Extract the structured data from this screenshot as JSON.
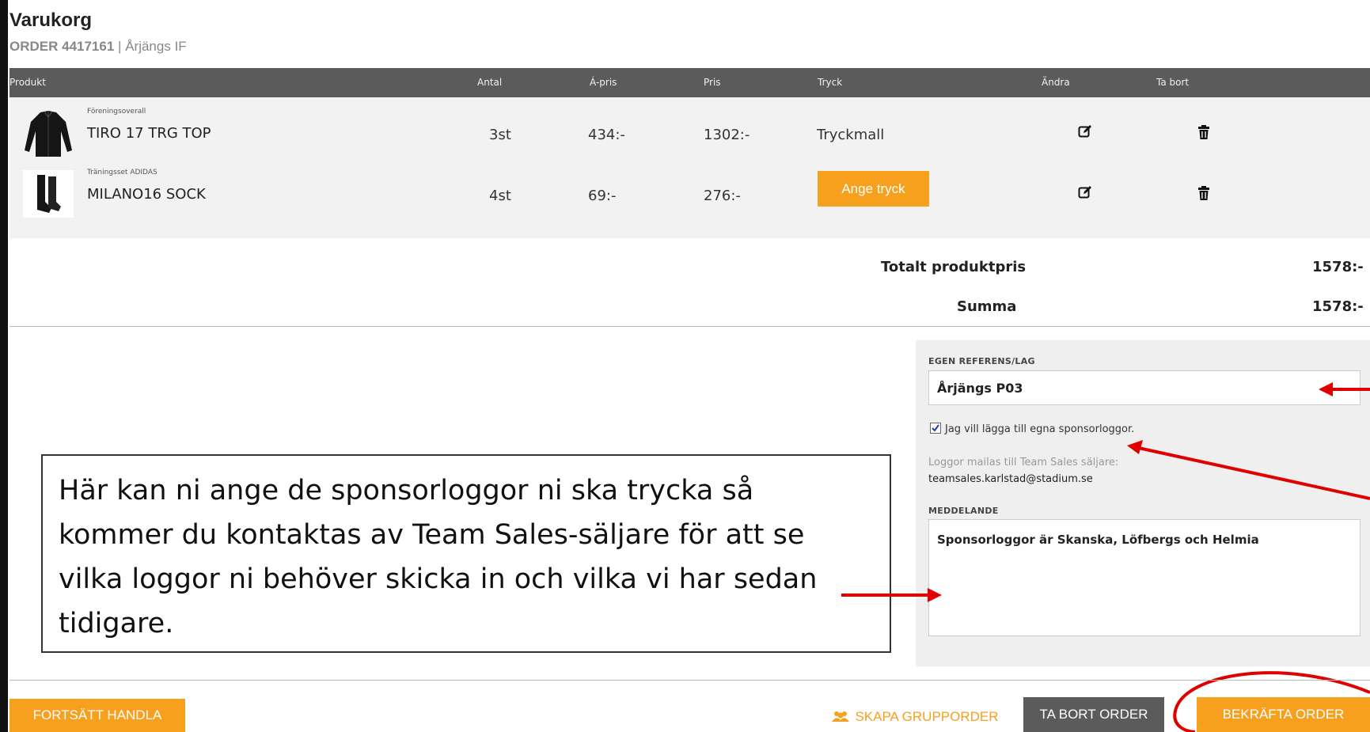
{
  "header": {
    "title": "Varukorg",
    "order_label": "ORDER 4417161",
    "separator": "|",
    "club": "Årjängs IF"
  },
  "table": {
    "columns": [
      "Produkt",
      "Antal",
      "Á-pris",
      "Pris",
      "Tryck",
      "Ändra",
      "Ta bort"
    ],
    "rows": [
      {
        "category": "Föreningsoverall",
        "name": "TIRO 17 TRG TOP",
        "qty": "3st",
        "unit_price": "434:-",
        "price": "1302:-",
        "print": "Tryckmall",
        "print_is_button": false
      },
      {
        "category": "Träningsset ADIDAS",
        "name": "MILANO16 SOCK",
        "qty": "4st",
        "unit_price": "69:-",
        "price": "276:-",
        "print": "Ange tryck",
        "print_is_button": true
      }
    ]
  },
  "totals": {
    "product_total_label": "Totalt produktpris",
    "product_total_value": "1578:-",
    "sum_label": "Summa",
    "sum_value": "1578:-"
  },
  "form": {
    "reference_label": "EGEN REFERENS/LAG",
    "reference_value": "Årjängs P03",
    "sponsor_checkbox_label": "Jag vill lägga till egna sponsorloggor.",
    "sponsor_checked": true,
    "logo_mail_note": "Loggor mailas till Team Sales säljare:",
    "logo_mail_address": "teamsales.karlstad@stadium.se",
    "message_label": "MEDDELANDE",
    "message_value": "Sponsorloggor är Skanska, Löfbergs och Helmia"
  },
  "callout": {
    "text": "Här kan ni ange de sponsorloggor ni ska trycka så kommer du kontaktas av Team Sales-säljare för att se vilka loggor ni behöver skicka in och vilka vi har sedan tidigare."
  },
  "footer": {
    "continue_label": "FORTSÄTT HANDLA",
    "group_order_label": "SKAPA GRUPPORDER",
    "delete_order_label": "TA BORT ORDER",
    "confirm_order_label": "BEKRÄFTA ORDER"
  },
  "colors": {
    "accent": "#f7a01d",
    "header_bar": "#5b5b5b",
    "annotation": "#e00000"
  }
}
